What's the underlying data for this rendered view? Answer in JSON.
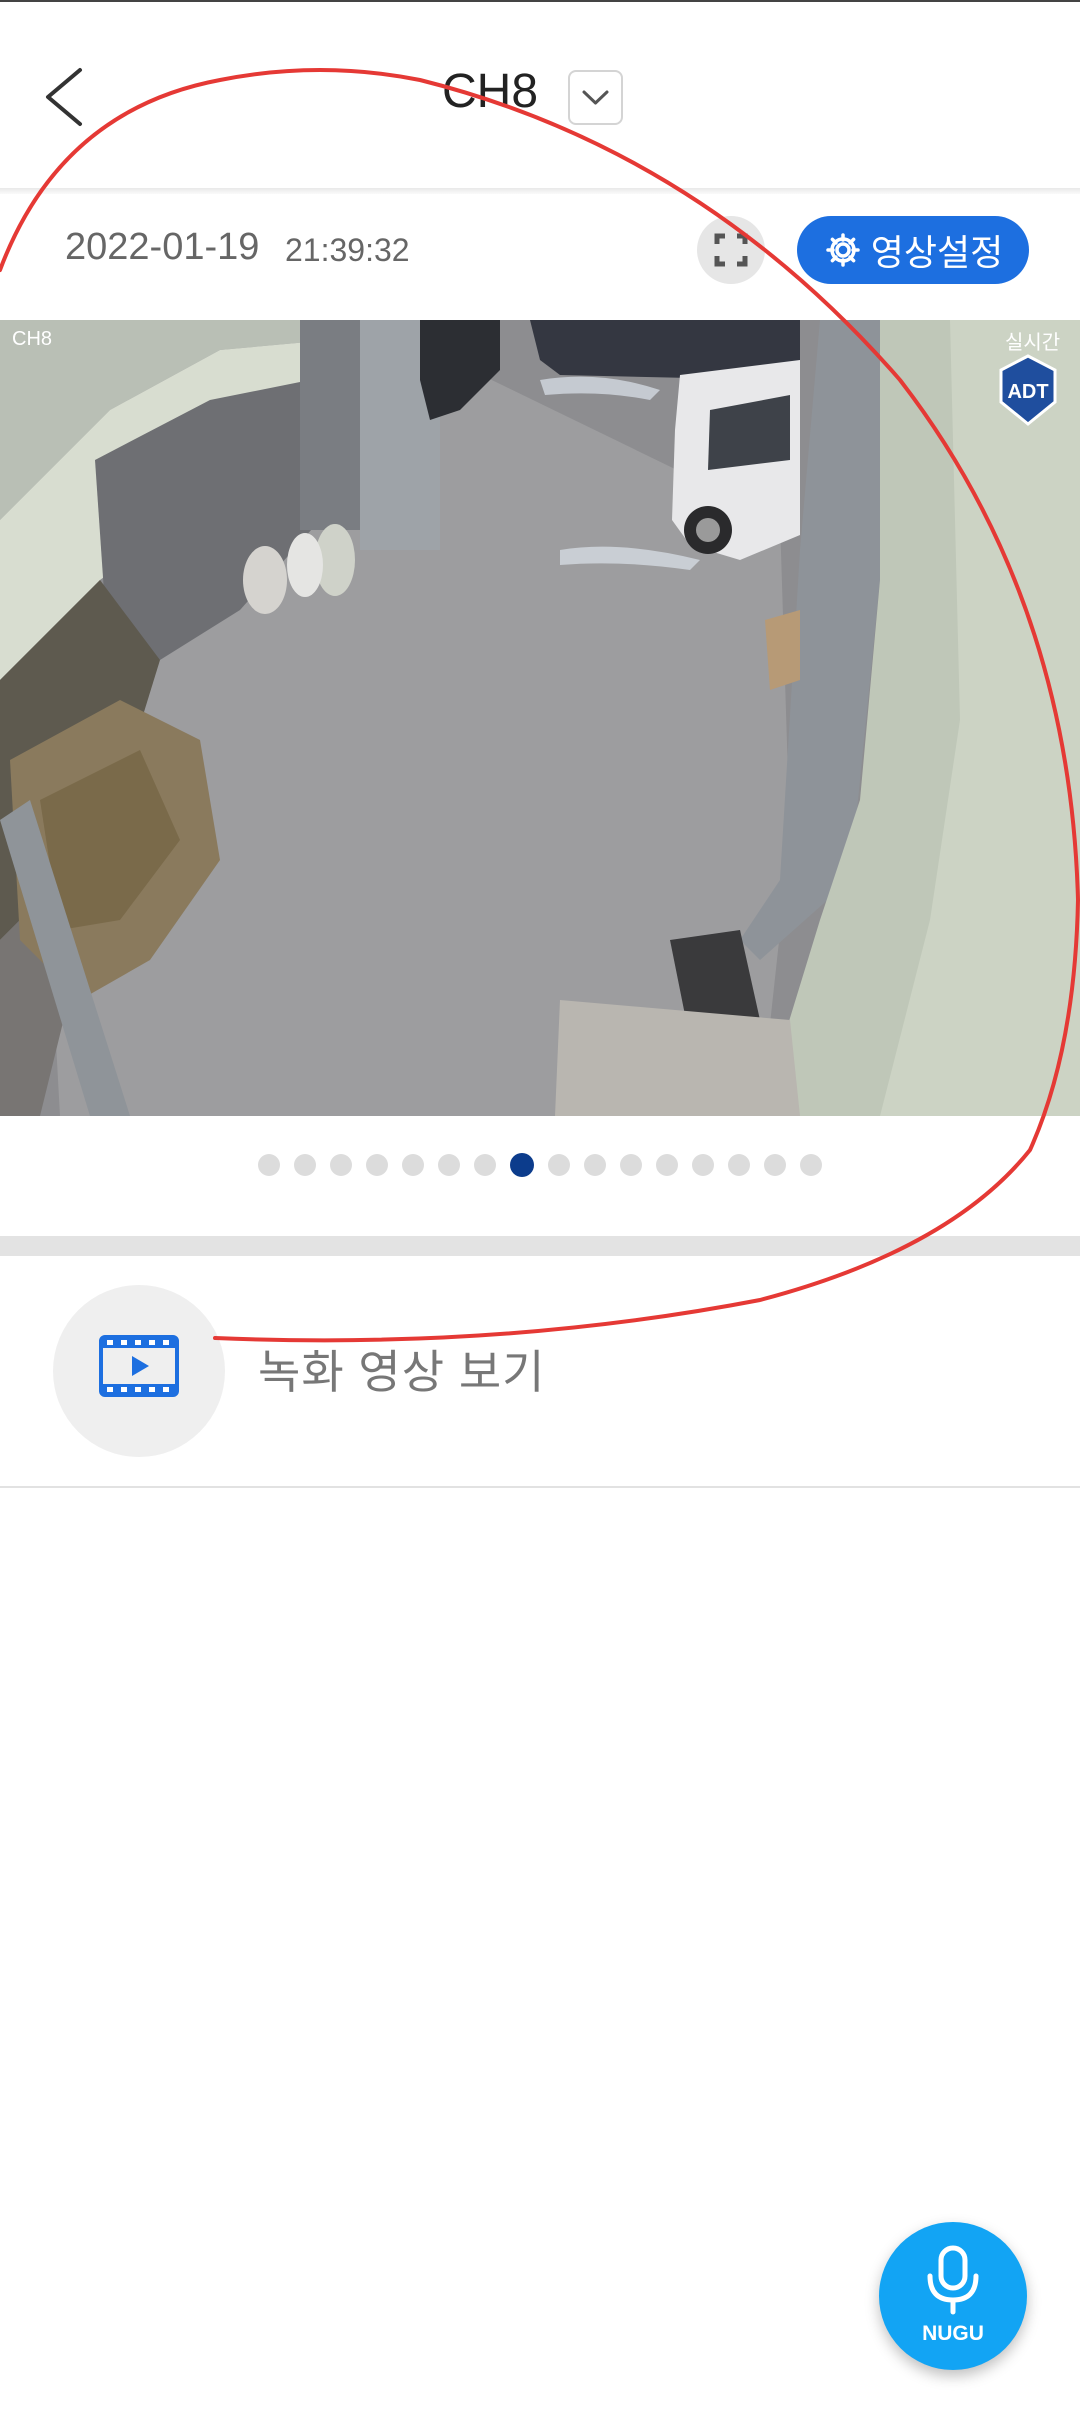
{
  "header": {
    "title": "CH8",
    "back_icon": "chevron-left-icon",
    "dropdown_icon": "chevron-down-icon"
  },
  "info_bar": {
    "date": "2022-01-19",
    "time": "21:39:32",
    "fullscreen_icon": "fullscreen-icon",
    "settings_label": "영상설정",
    "settings_icon": "gear-icon",
    "accent_color": "#1d6fe0"
  },
  "video": {
    "camera_label": "CH8",
    "live_label": "실시간",
    "logo_text": "ADT"
  },
  "pager": {
    "total": 16,
    "active_index": 7,
    "active_color": "#0c3c8c"
  },
  "record": {
    "label": "녹화 영상 보기",
    "icon": "video-play-icon"
  },
  "nugu": {
    "label": "NUGU",
    "icon": "microphone-icon",
    "color": "#12a4f4"
  },
  "annotation": {
    "color": "#e53935"
  }
}
